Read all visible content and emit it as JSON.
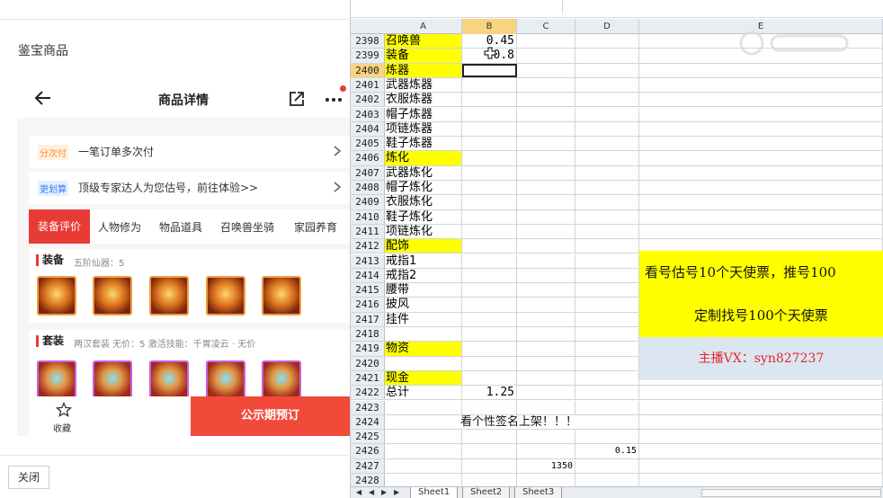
{
  "left_panel": {
    "title": "鉴宝商品",
    "close_label": "关闭"
  },
  "phone": {
    "header_title": "商品详情",
    "info_rows": [
      {
        "tag": "分次付",
        "text": "一笔订单多次付"
      },
      {
        "tag": "更划算",
        "text": "顶级专家达人为您估号，前往体验>>"
      }
    ],
    "tabs": [
      "装备评价",
      "人物修为",
      "物品道具",
      "召唤兽坐骑",
      "家园养育"
    ],
    "equip_section": {
      "title": "装备",
      "sub": "五阶仙器：5"
    },
    "set_section": {
      "title": "套装",
      "sub": "两汉套装  无价：5  激活技能：千胃凌云 · 无价"
    },
    "fav_label": "收藏",
    "buy_label": "公示期预订"
  },
  "sheet": {
    "columns": [
      "A",
      "B",
      "C",
      "D",
      "E"
    ],
    "rows": [
      {
        "n": "2398",
        "a": "召唤兽",
        "a_yellow": true,
        "b": "0.45"
      },
      {
        "n": "2399",
        "a": "装备",
        "a_yellow": true,
        "b": "0.8"
      },
      {
        "n": "2400",
        "a": "炼器",
        "a_yellow": true,
        "b": ""
      },
      {
        "n": "2401",
        "a": "武器炼器"
      },
      {
        "n": "2402",
        "a": "衣服炼器"
      },
      {
        "n": "2403",
        "a": "帽子炼器"
      },
      {
        "n": "2404",
        "a": "项链炼器"
      },
      {
        "n": "2405",
        "a": "鞋子炼器"
      },
      {
        "n": "2406",
        "a": "炼化",
        "a_yellow": true
      },
      {
        "n": "2407",
        "a": "武器炼化"
      },
      {
        "n": "2408",
        "a": "帽子炼化"
      },
      {
        "n": "2409",
        "a": "衣服炼化"
      },
      {
        "n": "2410",
        "a": "鞋子炼化"
      },
      {
        "n": "2411",
        "a": "项链炼化"
      },
      {
        "n": "2412",
        "a": "配饰",
        "a_yellow": true
      },
      {
        "n": "2413",
        "a": "戒指1"
      },
      {
        "n": "2414",
        "a": "戒指2"
      },
      {
        "n": "2415",
        "a": "腰带"
      },
      {
        "n": "2416",
        "a": "披风"
      },
      {
        "n": "2417",
        "a": "挂件"
      },
      {
        "n": "2418",
        "a": ""
      },
      {
        "n": "2419",
        "a": "物资",
        "a_yellow": true
      },
      {
        "n": "2420",
        "a": ""
      },
      {
        "n": "2421",
        "a": "现金",
        "a_yellow": true
      },
      {
        "n": "2422",
        "a": "总计",
        "b": "1.25"
      },
      {
        "n": "2423",
        "a": ""
      },
      {
        "n": "2424",
        "a": "",
        "merged": "看个性签名上架！！！"
      },
      {
        "n": "2425",
        "a": ""
      },
      {
        "n": "2426",
        "a": "",
        "d": "0.15"
      },
      {
        "n": "2427",
        "a": "",
        "c": "1350"
      },
      {
        "n": "2428",
        "a": ""
      }
    ],
    "banners": {
      "b1": "看号估号10个天使票，推号100",
      "b2": "定制找号100个天使票",
      "b3": "主播VX：syn827237"
    },
    "sheet_tabs": [
      "Sheet1",
      "Sheet2",
      "Sheet3"
    ],
    "selected_row": "2400",
    "selected_col": "B"
  },
  "colors": {
    "accent_red": "#e83b36",
    "yellow_fill": "#ffff00",
    "banner_blue": "#dce6f1"
  }
}
